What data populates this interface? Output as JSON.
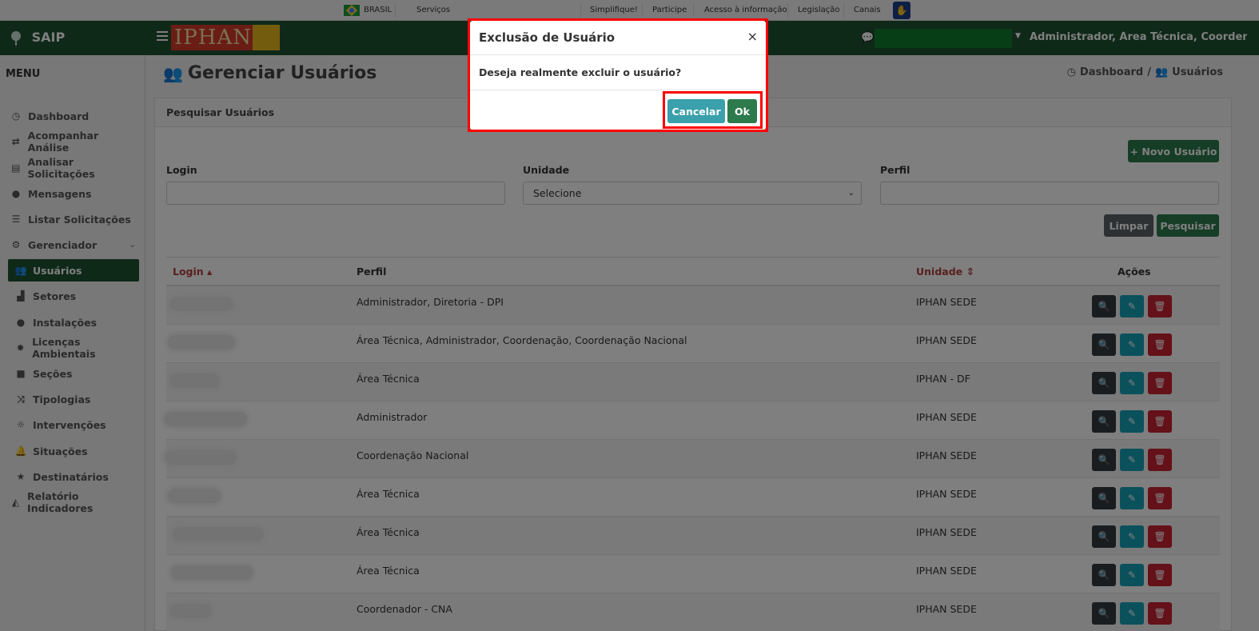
{
  "govbar": {
    "country": "BRASIL",
    "services": "Serviços",
    "links": [
      "Simplifique!",
      "Participe",
      "Acesso à informação",
      "Legislação",
      "Canais"
    ],
    "accessibility_icon": "vlibras-hand-icon"
  },
  "header": {
    "brand": "SAIP",
    "logo_text": "IPHAN",
    "user_roles": "Administrador, Área Técnica, Coordenação..."
  },
  "sidebar": {
    "title": "MENU",
    "items": [
      {
        "label": "Dashboard",
        "icon": "dashboard-icon"
      },
      {
        "label": "Acompanhar Análise",
        "icon": "exchange-icon"
      },
      {
        "label": "Analisar Solicitações",
        "icon": "book-icon"
      },
      {
        "label": "Mensagens",
        "icon": "comments-icon"
      },
      {
        "label": "Listar Solicitações",
        "icon": "list-icon"
      },
      {
        "label": "Gerenciador",
        "icon": "cogs-icon"
      },
      {
        "label": "Usuários",
        "icon": "users-icon"
      },
      {
        "label": "Setores",
        "icon": "industry-icon"
      },
      {
        "label": "Instalações",
        "icon": "circle-icon"
      },
      {
        "label": "Licenças Ambientais",
        "icon": "certificate-icon"
      },
      {
        "label": "Seções",
        "icon": "square-icon"
      },
      {
        "label": "Tipologias",
        "icon": "random-icon"
      },
      {
        "label": "Intervenções",
        "icon": "sun-icon"
      },
      {
        "label": "Situações",
        "icon": "bell-icon"
      },
      {
        "label": "Destinatários",
        "icon": "star-icon"
      },
      {
        "label": "Relatório Indicadores",
        "icon": "area-chart-icon"
      }
    ]
  },
  "main": {
    "title": "Gerenciar Usuários",
    "breadcrumb": [
      "Dashboard",
      "/",
      "Usuários"
    ],
    "panel_title": "Pesquisar Usuários",
    "new_user_button": "Novo Usuário",
    "filters": {
      "login_label": "Login",
      "unidade_label": "Unidade",
      "unidade_value": "Selecione",
      "perfil_label": "Perfil"
    },
    "clear_button": "Limpar",
    "search_button": "Pesquisar",
    "table": {
      "headers": [
        "Login",
        "Perfil",
        "Unidade",
        "Ações"
      ],
      "rows": [
        {
          "perfil": "Administrador, Diretoria - DPI",
          "unidade": "IPHAN SEDE"
        },
        {
          "perfil": "Área Técnica, Administrador, Coordenação, Coordenação Nacional",
          "unidade": "IPHAN SEDE"
        },
        {
          "perfil": "Área Técnica",
          "unidade": "IPHAN - DF"
        },
        {
          "perfil": "Administrador",
          "unidade": "IPHAN SEDE"
        },
        {
          "perfil": "Coordenação Nacional",
          "unidade": "IPHAN SEDE"
        },
        {
          "perfil": "Área Técnica",
          "unidade": "IPHAN SEDE"
        },
        {
          "perfil": "Área Técnica",
          "unidade": "IPHAN SEDE"
        },
        {
          "perfil": "Área Técnica",
          "unidade": "IPHAN SEDE"
        },
        {
          "perfil": "Coordenador - CNA",
          "unidade": "IPHAN SEDE"
        }
      ]
    }
  },
  "modal": {
    "title": "Exclusão de Usuário",
    "close": "×",
    "body": "Deseja realmente excluir o usuário?",
    "cancel": "Cancelar",
    "ok": "Ok"
  },
  "colors": {
    "header_green": "#1f5233",
    "primary_green": "#2d7a4c",
    "info": "#3aa0ac",
    "danger": "#c82333",
    "highlight": "#ff0000"
  }
}
